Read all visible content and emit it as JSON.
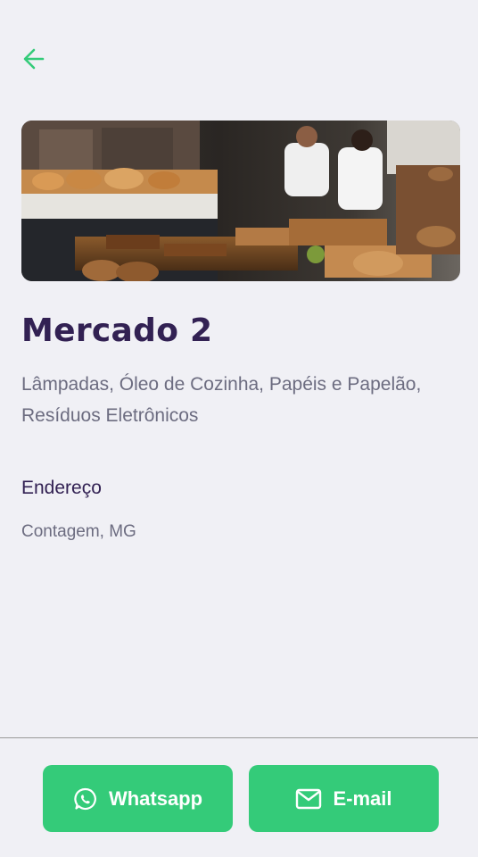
{
  "header": {
    "back_icon": "arrow-left-icon"
  },
  "point": {
    "image_description_icon": "photo",
    "name": "Mercado 2",
    "items": "Lâmpadas, Óleo de Cozinha, Papéis e Papelão, Resíduos Eletrônicos"
  },
  "address": {
    "title": "Endereço",
    "value": "Contagem, MG"
  },
  "footer": {
    "whatsapp_label": "Whatsapp",
    "whatsapp_icon": "whatsapp-icon",
    "email_label": "E-mail",
    "email_icon": "mail-icon"
  },
  "colors": {
    "background": "#f0f0f5",
    "accent": "#34cb79",
    "title": "#322153",
    "text": "#6c6c80"
  }
}
